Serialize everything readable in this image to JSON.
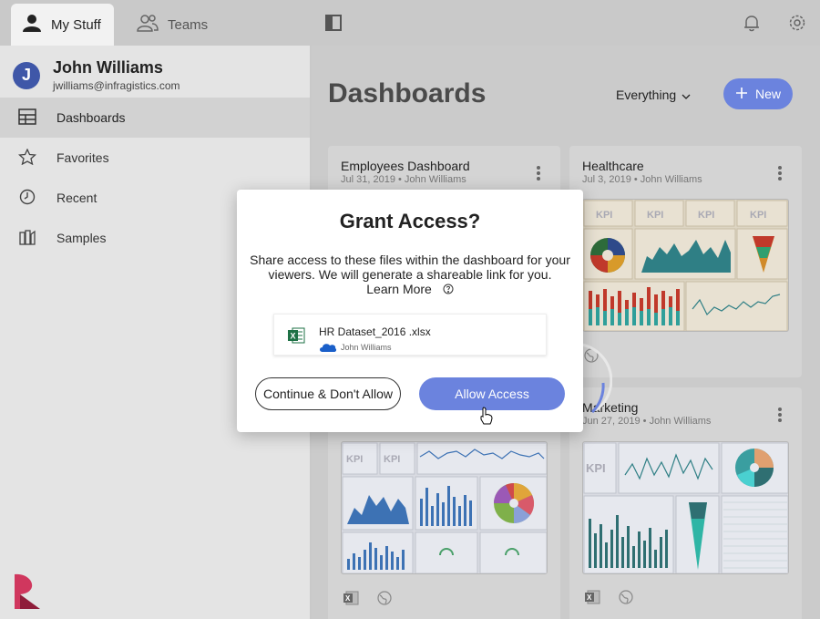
{
  "tabs": {
    "my_stuff": "My Stuff",
    "teams": "Teams"
  },
  "user": {
    "initial": "J",
    "name": "John Williams",
    "email": "jwilliams@infragistics.com"
  },
  "nav": [
    {
      "label": "Dashboards",
      "icon": "dashboard-icon",
      "active": true
    },
    {
      "label": "Favorites",
      "icon": "star-icon"
    },
    {
      "label": "Recent",
      "icon": "clock-icon"
    },
    {
      "label": "Samples",
      "icon": "samples-icon"
    }
  ],
  "main": {
    "title": "Dashboards",
    "filter": "Everything",
    "new_label": "New"
  },
  "cards": [
    {
      "title": "Employees Dashboard",
      "meta": "Jul 31, 2019 • John Williams"
    },
    {
      "title": "Healthcare",
      "meta": "Jul 3, 2019 • John Williams"
    },
    {
      "title": "Marketing",
      "meta": "Jun 27, 2019 • John Williams"
    }
  ],
  "kpi_label": "KPI",
  "dialog": {
    "title": "Grant Access?",
    "body": "Share access to these files within the dashboard for your viewers. We will generate a shareable link for you.",
    "learn_more": "Learn More",
    "file_name": "HR Dataset_2016 .xlsx",
    "file_owner": "John Williams",
    "deny_label": "Continue & Don't Allow",
    "allow_label": "Allow Access"
  },
  "colors": {
    "accent": "#6b83de",
    "avatar": "#3f57a8",
    "excel": "#1e7145"
  }
}
